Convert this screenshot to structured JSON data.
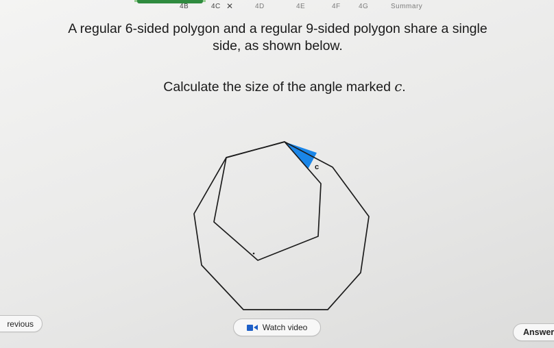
{
  "tabs": [
    {
      "label": "4B",
      "state": "done"
    },
    {
      "label": "4C",
      "state": "current",
      "status_icon": "cross-icon",
      "status_glyph": "✕"
    },
    {
      "label": "4D",
      "state": "pending"
    },
    {
      "label": "4E",
      "state": "pending"
    },
    {
      "label": "4F",
      "state": "pending"
    },
    {
      "label": "4G",
      "state": "pending"
    },
    {
      "label": "Summary",
      "state": "pending"
    }
  ],
  "question": {
    "line1": "A regular 6-sided polygon and a regular 9-sided polygon share a single",
    "line2": "side, as shown below.",
    "instruction_prefix": "Calculate the size of the angle marked ",
    "angle_variable": "c",
    "instruction_suffix": "."
  },
  "diagram": {
    "hexagon_sides": 6,
    "nonagon_sides": 9,
    "angle_label": "c",
    "angle_highlight_color": "#1a86e8",
    "line_color": "#1c1c1c"
  },
  "buttons": {
    "previous_label": "revious",
    "video_label": "Watch video",
    "answer_label": "Answer"
  },
  "colors": {
    "accent_green": "#2f8b3f",
    "video_icon_blue": "#1d5fc7"
  }
}
